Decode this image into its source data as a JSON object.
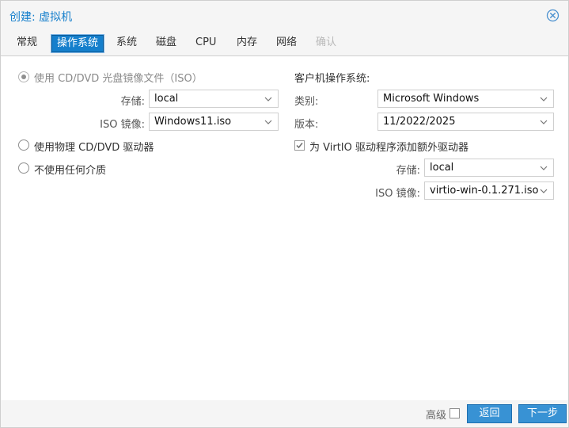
{
  "window": {
    "title": "创建: 虚拟机"
  },
  "tabs": [
    {
      "label": "常规"
    },
    {
      "label": "操作系统"
    },
    {
      "label": "系统"
    },
    {
      "label": "磁盘"
    },
    {
      "label": "CPU"
    },
    {
      "label": "内存"
    },
    {
      "label": "网络"
    },
    {
      "label": "确认"
    }
  ],
  "active_tab": "操作系统",
  "media": {
    "iso_option_label": "使用 CD/DVD 光盘镜像文件（ISO）",
    "storage_label": "存储:",
    "storage_value": "local",
    "iso_label": "ISO 镜像:",
    "iso_value": "Windows11.iso",
    "physical_option_label": "使用物理 CD/DVD 驱动器",
    "none_option_label": "不使用任何介质",
    "selected": "iso"
  },
  "guest": {
    "heading": "客户机操作系统:",
    "type_label": "类别:",
    "type_value": "Microsoft Windows",
    "version_label": "版本:",
    "version_value": "11/2022/2025",
    "virtio_label": "为 VirtIO 驱动程序添加额外驱动器",
    "virtio_checked": true,
    "virtio_storage_label": "存储:",
    "virtio_storage_value": "local",
    "virtio_iso_label": "ISO 镜像:",
    "virtio_iso_value": "virtio-win-0.1.271.iso"
  },
  "footer": {
    "advanced_label": "高级",
    "advanced_checked": false,
    "back_label": "返回",
    "next_label": "下一步"
  },
  "colors": {
    "accent": "#157fcc",
    "button": "#3892d4"
  },
  "icons": {
    "close": "close-circle-icon",
    "dropdown": "chevron-down-icon",
    "check": "checkmark-icon"
  }
}
